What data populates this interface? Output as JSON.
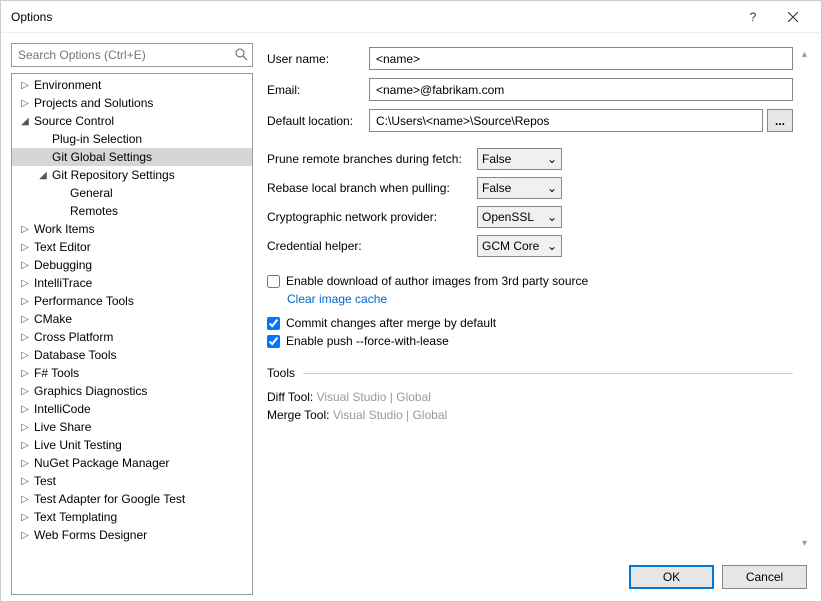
{
  "window": {
    "title": "Options"
  },
  "search": {
    "placeholder": "Search Options (Ctrl+E)"
  },
  "tree": [
    {
      "label": "Environment",
      "depth": 0,
      "arrow": "▷",
      "sel": false
    },
    {
      "label": "Projects and Solutions",
      "depth": 0,
      "arrow": "▷",
      "sel": false
    },
    {
      "label": "Source Control",
      "depth": 0,
      "arrow": "◢",
      "sel": false
    },
    {
      "label": "Plug-in Selection",
      "depth": 1,
      "arrow": "",
      "sel": false
    },
    {
      "label": "Git Global Settings",
      "depth": 1,
      "arrow": "",
      "sel": true
    },
    {
      "label": "Git Repository Settings",
      "depth": 1,
      "arrow": "◢",
      "sel": false
    },
    {
      "label": "General",
      "depth": 2,
      "arrow": "",
      "sel": false
    },
    {
      "label": "Remotes",
      "depth": 2,
      "arrow": "",
      "sel": false
    },
    {
      "label": "Work Items",
      "depth": 0,
      "arrow": "▷",
      "sel": false
    },
    {
      "label": "Text Editor",
      "depth": 0,
      "arrow": "▷",
      "sel": false
    },
    {
      "label": "Debugging",
      "depth": 0,
      "arrow": "▷",
      "sel": false
    },
    {
      "label": "IntelliTrace",
      "depth": 0,
      "arrow": "▷",
      "sel": false
    },
    {
      "label": "Performance Tools",
      "depth": 0,
      "arrow": "▷",
      "sel": false
    },
    {
      "label": "CMake",
      "depth": 0,
      "arrow": "▷",
      "sel": false
    },
    {
      "label": "Cross Platform",
      "depth": 0,
      "arrow": "▷",
      "sel": false
    },
    {
      "label": "Database Tools",
      "depth": 0,
      "arrow": "▷",
      "sel": false
    },
    {
      "label": "F# Tools",
      "depth": 0,
      "arrow": "▷",
      "sel": false
    },
    {
      "label": "Graphics Diagnostics",
      "depth": 0,
      "arrow": "▷",
      "sel": false
    },
    {
      "label": "IntelliCode",
      "depth": 0,
      "arrow": "▷",
      "sel": false
    },
    {
      "label": "Live Share",
      "depth": 0,
      "arrow": "▷",
      "sel": false
    },
    {
      "label": "Live Unit Testing",
      "depth": 0,
      "arrow": "▷",
      "sel": false
    },
    {
      "label": "NuGet Package Manager",
      "depth": 0,
      "arrow": "▷",
      "sel": false
    },
    {
      "label": "Test",
      "depth": 0,
      "arrow": "▷",
      "sel": false
    },
    {
      "label": "Test Adapter for Google Test",
      "depth": 0,
      "arrow": "▷",
      "sel": false
    },
    {
      "label": "Text Templating",
      "depth": 0,
      "arrow": "▷",
      "sel": false
    },
    {
      "label": "Web Forms Designer",
      "depth": 0,
      "arrow": "▷",
      "sel": false
    }
  ],
  "form": {
    "username_label": "User name:",
    "username_value": "<name>",
    "email_label": "Email:",
    "email_value": "<name>@fabrikam.com",
    "location_label": "Default location:",
    "location_value": "C:\\Users\\<name>\\Source\\Repos",
    "browse": "..."
  },
  "combos": {
    "prune_label": "Prune remote branches during fetch:",
    "prune_value": "False",
    "rebase_label": "Rebase local branch when pulling:",
    "rebase_value": "False",
    "crypto_label": "Cryptographic network provider:",
    "crypto_value": "OpenSSL",
    "cred_label": "Credential helper:",
    "cred_value": "GCM Core"
  },
  "checks": {
    "authorimg": "Enable download of author images from 3rd party source",
    "clearcache": "Clear image cache",
    "commitmerge": "Commit changes after merge by default",
    "forcelease": "Enable push --force-with-lease"
  },
  "tools": {
    "heading": "Tools",
    "diff_label": "Diff Tool:",
    "diff_v1": "Visual Studio",
    "sep": "|",
    "diff_v2": "Global",
    "merge_label": "Merge Tool:",
    "merge_v1": "Visual Studio",
    "merge_v2": "Global"
  },
  "buttons": {
    "ok": "OK",
    "cancel": "Cancel"
  }
}
